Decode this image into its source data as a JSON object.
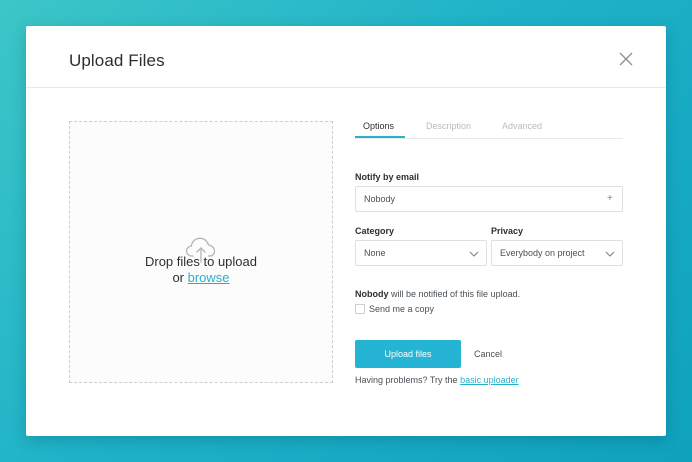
{
  "modal": {
    "title": "Upload Files"
  },
  "dropzone": {
    "line1": "Drop files to upload",
    "or_text": "or",
    "browse_link": "browse"
  },
  "tabs": [
    {
      "label": "Options",
      "active": true
    },
    {
      "label": "Description",
      "active": false
    },
    {
      "label": "Advanced",
      "active": false
    }
  ],
  "notify": {
    "label": "Notify by email",
    "value": "Nobody"
  },
  "category": {
    "label": "Category",
    "value": "None"
  },
  "privacy": {
    "label": "Privacy",
    "value": "Everybody on project"
  },
  "notice": {
    "bold": "Nobody",
    "rest": "will be notified of this file upload."
  },
  "send_copy": {
    "label": "Send me a copy",
    "checked": false
  },
  "actions": {
    "upload_label": "Upload files",
    "cancel_label": "Cancel"
  },
  "help": {
    "prefix": "Having problems? Try the",
    "link": "basic uploader"
  },
  "colors": {
    "accent": "#26b4d4",
    "background_start": "#3cc6c7",
    "background_end": "#0fa2bd"
  },
  "icons": {
    "close": "close-icon",
    "cloud_upload": "cloud-upload-icon",
    "plus": "plus-icon",
    "chevron": "chevron-down-icon"
  }
}
